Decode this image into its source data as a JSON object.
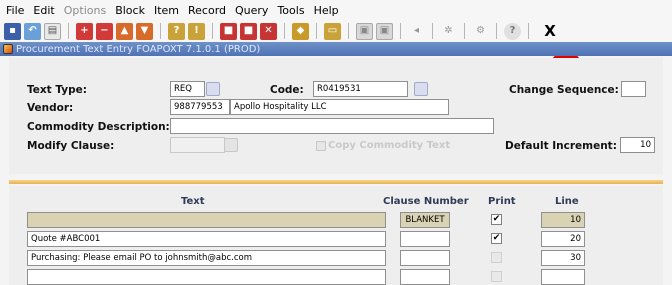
{
  "menu": [
    {
      "label": "File",
      "enabled": true
    },
    {
      "label": "Edit",
      "enabled": true
    },
    {
      "label": "Options",
      "enabled": false
    },
    {
      "label": "Block",
      "enabled": true
    },
    {
      "label": "Item",
      "enabled": true
    },
    {
      "label": "Record",
      "enabled": true
    },
    {
      "label": "Query",
      "enabled": true
    },
    {
      "label": "Tools",
      "enabled": true
    },
    {
      "label": "Help",
      "enabled": true
    }
  ],
  "toolbar": {
    "exit_label": "X"
  },
  "window": {
    "title": "Procurement Text Entry  FOAPOXT  7.1.0.1  (PROD)"
  },
  "key": {
    "text_type_label": "Text Type:",
    "text_type_value": "REQ",
    "code_label": "Code:",
    "code_value": "R0419531",
    "change_sequence_label": "Change Sequence:",
    "change_sequence_value": "",
    "vendor_label": "Vendor:",
    "vendor_id": "988779553",
    "vendor_name": "Apollo Hospitality LLC",
    "commodity_label": "Commodity Description:",
    "commodity_value": "",
    "modify_clause_label": "Modify Clause:",
    "modify_clause_value": "",
    "copy_commodity_label": "Copy Commodity Text",
    "default_increment_label": "Default Increment:",
    "default_increment_value": "10"
  },
  "detail": {
    "headers": {
      "text": "Text",
      "clause": "Clause Number",
      "print": "Print",
      "line": "Line"
    },
    "rows": [
      {
        "text": "",
        "clause": "BLANKET",
        "print": true,
        "line": "10"
      },
      {
        "text": "Quote #ABC001",
        "clause": "",
        "print": true,
        "line": "20"
      },
      {
        "text": "Purchasing: Please email PO to johnsmith@abc.com",
        "clause": "",
        "print": false,
        "line": "30"
      },
      {
        "text": "",
        "clause": "",
        "print": false,
        "line": ""
      }
    ]
  },
  "colors": {
    "title_bar": "#4f72b4",
    "divider": "#e7b24e",
    "highlight_row": "#d9d3b3",
    "annotation_arrow": "#e00000"
  }
}
